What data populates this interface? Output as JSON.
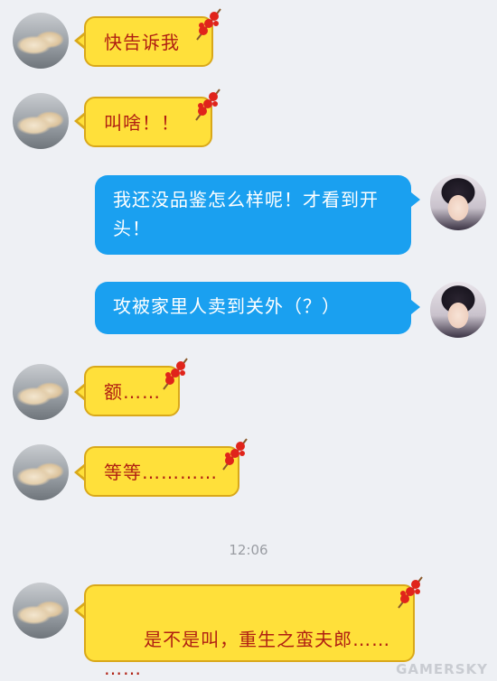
{
  "messages": [
    {
      "side": "left",
      "text": "快告诉我"
    },
    {
      "side": "left",
      "text": "叫啥！！"
    },
    {
      "side": "right",
      "text": "我还没品鉴怎么样呢！才看到开头！"
    },
    {
      "side": "right",
      "text": "攻被家里人卖到关外（？）"
    },
    {
      "side": "left",
      "text": "额……"
    },
    {
      "side": "left",
      "text": "等等…………"
    },
    {
      "side": "left",
      "text": "是不是叫，重生之蛮夫郎……\n……"
    }
  ],
  "timestamp": "12:06",
  "watermark": "GAMERSKY",
  "colors": {
    "background": "#eef0f4",
    "yellow_bubble": "#ffe03a",
    "yellow_text": "#b01f12",
    "blue_bubble": "#1aa0f0",
    "blue_text": "#ffffff"
  },
  "icons": {
    "left_avatar": "cat-avatar-icon",
    "right_avatar": "man-avatar-icon",
    "bubble_decoration": "candied-haws-icon"
  }
}
